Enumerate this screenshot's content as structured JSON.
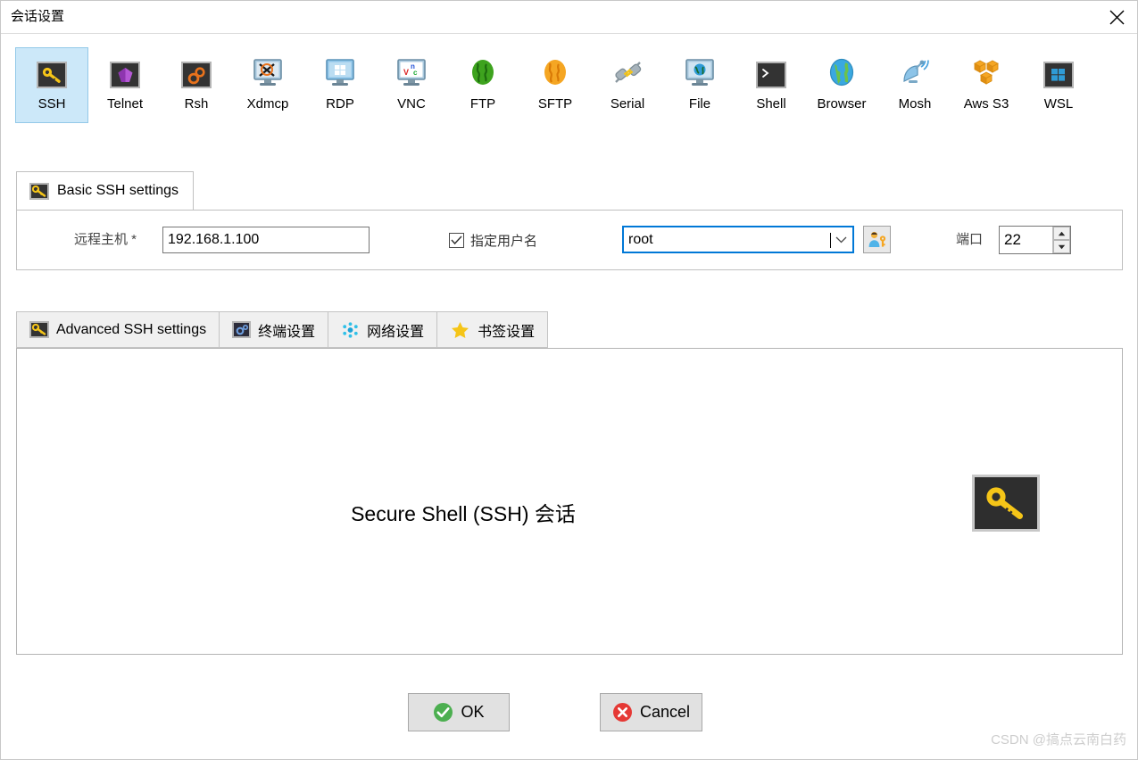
{
  "window": {
    "title": "会话设置",
    "close_icon": "close-icon"
  },
  "protocols": [
    {
      "label": "SSH",
      "icon": "ssh-key-icon",
      "selected": true
    },
    {
      "label": "Telnet",
      "icon": "telnet-crystal-icon",
      "selected": false
    },
    {
      "label": "Rsh",
      "icon": "rsh-gears-icon",
      "selected": false
    },
    {
      "label": "Xdmcp",
      "icon": "xdmcp-monitor-icon",
      "selected": false
    },
    {
      "label": "RDP",
      "icon": "rdp-windows-icon",
      "selected": false
    },
    {
      "label": "VNC",
      "icon": "vnc-monitor-icon",
      "selected": false
    },
    {
      "label": "FTP",
      "icon": "ftp-green-globe-icon",
      "selected": false
    },
    {
      "label": "SFTP",
      "icon": "sftp-orange-globe-icon",
      "selected": false
    },
    {
      "label": "Serial",
      "icon": "serial-plug-icon",
      "selected": false
    },
    {
      "label": "File",
      "icon": "file-monitor-globe-icon",
      "selected": false
    },
    {
      "label": "Shell",
      "icon": "shell-prompt-icon",
      "selected": false
    },
    {
      "label": "Browser",
      "icon": "browser-globe-icon",
      "selected": false
    },
    {
      "label": "Mosh",
      "icon": "mosh-satellite-icon",
      "selected": false
    },
    {
      "label": "Aws S3",
      "icon": "aws-s3-cubes-icon",
      "selected": false
    },
    {
      "label": "WSL",
      "icon": "wsl-windows-icon",
      "selected": false
    }
  ],
  "basic": {
    "tab_label": "Basic SSH settings",
    "tab_icon": "key-icon",
    "host_label": "远程主机 *",
    "host_value": "192.168.1.100",
    "host_placeholder": "",
    "specify_user_label": "指定用户名",
    "specify_user_checked": true,
    "username_value": "root",
    "username_placeholder": "",
    "user_button_icon": "user-key-icon",
    "port_label": "端口",
    "port_value": "22"
  },
  "advanced": {
    "tabs": [
      {
        "label": "Advanced SSH settings",
        "icon": "key-icon",
        "active": true
      },
      {
        "label": "终端设置",
        "icon": "terminal-gear-icon",
        "active": false
      },
      {
        "label": "网络设置",
        "icon": "network-dots-icon",
        "active": false
      },
      {
        "label": "书签设置",
        "icon": "star-icon",
        "active": false
      }
    ],
    "center_text": "Secure Shell (SSH) 会话",
    "big_icon": "ssh-key-icon"
  },
  "footer": {
    "ok_label": "OK",
    "ok_icon": "check-circle-icon",
    "cancel_label": "Cancel",
    "cancel_icon": "x-circle-icon"
  },
  "watermark": "CSDN @搞点云南白药",
  "colors": {
    "selection": "#cce8f9",
    "focus_border": "#0078d7",
    "key_gold": "#f5c518",
    "ok_green": "#4caf50",
    "cancel_red": "#e53935"
  }
}
